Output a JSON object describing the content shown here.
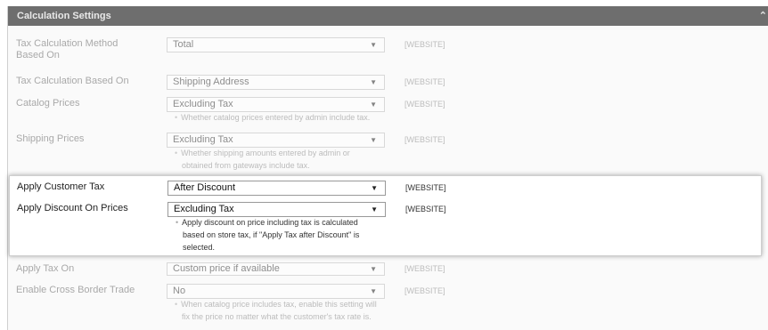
{
  "section": {
    "title": "Calculation Settings",
    "collapse_icon": "chevron-up-icon"
  },
  "rows": [
    {
      "label": "Tax Calculation Method Based On",
      "value": "Total",
      "scope": "[WEBSITE]",
      "note": []
    },
    {
      "label": "Tax Calculation Based On",
      "value": "Shipping Address",
      "scope": "[WEBSITE]",
      "note": []
    },
    {
      "label": "Catalog Prices",
      "value": "Excluding Tax",
      "scope": "[WEBSITE]",
      "note": [
        "Whether catalog prices entered by admin include tax."
      ]
    },
    {
      "label": "Shipping Prices",
      "value": "Excluding Tax",
      "scope": "[WEBSITE]",
      "note": [
        "Whether shipping amounts entered by admin or",
        "obtained from gateways include tax."
      ]
    },
    {
      "label": "Apply Customer Tax",
      "value": "After Discount",
      "scope": "[WEBSITE]",
      "note": []
    },
    {
      "label": "Apply Discount On Prices",
      "value": "Excluding Tax",
      "scope": "[WEBSITE]",
      "note": [
        "Apply discount on price including tax is calculated",
        "based on store tax, if \"Apply Tax after Discount\" is",
        "selected."
      ]
    },
    {
      "label": "Apply Tax On",
      "value": "Custom price if available",
      "scope": "[WEBSITE]",
      "note": []
    },
    {
      "label": "Enable Cross Border Trade",
      "value": "No",
      "scope": "[WEBSITE]",
      "note": [
        "When catalog price includes tax, enable this setting will",
        "fix the price no matter what the customer's tax rate is."
      ]
    }
  ],
  "colors": {
    "header": "#6e6e6e",
    "highlight_bg": "#ffffff",
    "panel_bg": "#fafafa"
  }
}
